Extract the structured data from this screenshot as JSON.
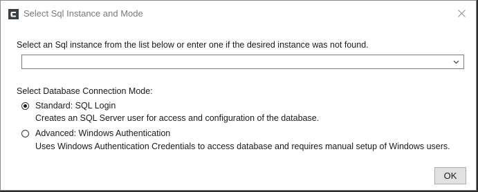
{
  "window": {
    "title": "Select Sql Instance and Mode",
    "close_icon": "close-icon",
    "app_icon": "app-logo-icon"
  },
  "instance": {
    "instruction": "Select an Sql instance from the list below or enter one if the desired instance was not found.",
    "combo_value": "",
    "combo_icon": "chevron-down-icon"
  },
  "mode": {
    "label": "Select Database Connection Mode:",
    "options": [
      {
        "label": "Standard: SQL Login",
        "description": "Creates an SQL Server user for access and configuration of the database.",
        "selected": true
      },
      {
        "label": "Advanced: Windows Authentication",
        "description": "Uses Windows Authentication Credentials to access database and requires manual setup of Windows users.",
        "selected": false
      }
    ]
  },
  "footer": {
    "ok_label": "OK"
  }
}
